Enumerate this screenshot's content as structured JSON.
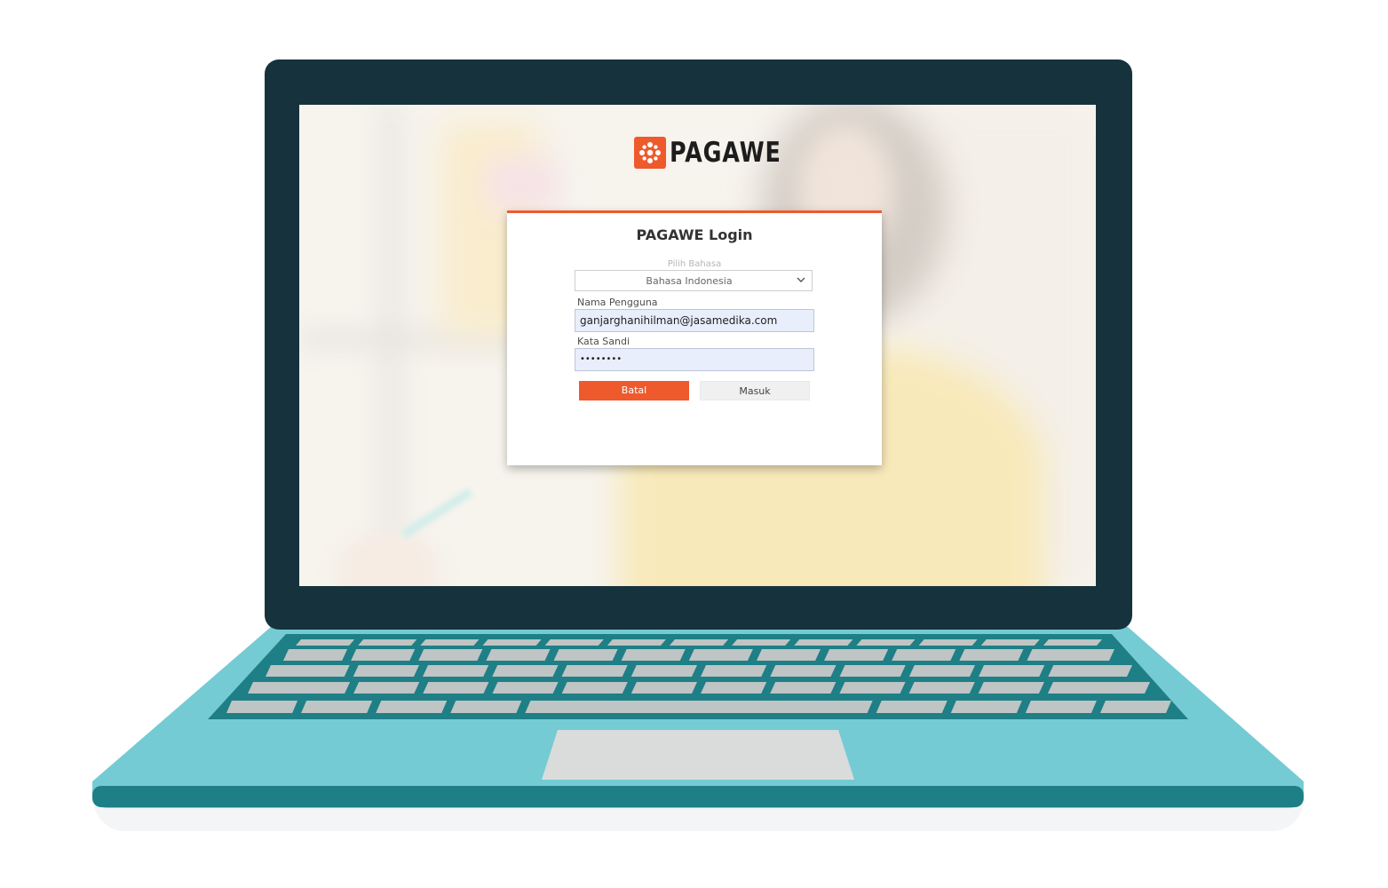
{
  "brand": {
    "name": "PAGAWE",
    "accent_color": "#ee5a2c",
    "logo_icon": "pagawe-logo-icon"
  },
  "login": {
    "title": "PAGAWE Login",
    "language_label": "Pilih Bahasa",
    "language_value": "Bahasa Indonesia",
    "username_label": "Nama Pengguna",
    "username_value": "ganjarghanihilman@jasamedika.com",
    "password_label": "Kata Sandi",
    "password_value": "••••••••",
    "cancel_label": "Batal",
    "submit_label": "Masuk"
  },
  "colors": {
    "laptop_bezel": "#16333d",
    "laptop_body": "#74cbd3",
    "keyboard_deck": "#1e7f86",
    "key": "#bfc4c4",
    "trackpad": "#d9dcdb"
  }
}
